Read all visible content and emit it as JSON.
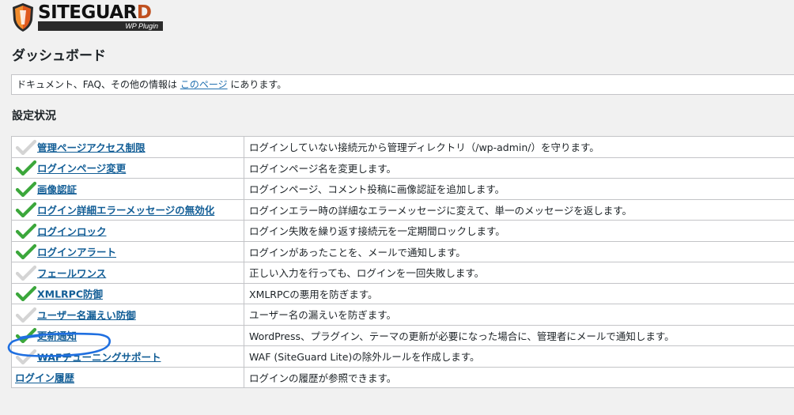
{
  "logo": {
    "brand_main": "SITEGUAR",
    "brand_accent": "D",
    "sub": "WP Plugin"
  },
  "page": {
    "title": "ダッシュボード"
  },
  "notice": {
    "prefix": "ドキュメント、FAQ、その他の情報は ",
    "link": "このページ",
    "suffix": " にあります。"
  },
  "section": {
    "title": "設定状況"
  },
  "colors": {
    "enabled_check": "#3ba73b",
    "disabled_check": "#d4d4d4",
    "annotation": "#1f6fe0"
  },
  "features": [
    {
      "name": "管理ページアクセス制限",
      "status": "disabled",
      "desc": "ログインしていない接続元から管理ディレクトリ（/wp-admin/）を守ります。"
    },
    {
      "name": "ログインページ変更",
      "status": "enabled",
      "desc": "ログインページ名を変更します。"
    },
    {
      "name": "画像認証",
      "status": "enabled",
      "desc": "ログインページ、コメント投稿に画像認証を追加します。"
    },
    {
      "name": "ログイン詳細エラーメッセージの無効化",
      "status": "enabled",
      "desc": "ログインエラー時の詳細なエラーメッセージに変えて、単一のメッセージを返します。"
    },
    {
      "name": "ログインロック",
      "status": "enabled",
      "desc": "ログイン失敗を繰り返す接続元を一定期間ロックします。"
    },
    {
      "name": "ログインアラート",
      "status": "enabled",
      "desc": "ログインがあったことを、メールで通知します。"
    },
    {
      "name": "フェールワンス",
      "status": "disabled",
      "desc": "正しい入力を行っても、ログインを一回失敗します。"
    },
    {
      "name": "XMLRPC防御",
      "status": "enabled",
      "desc": "XMLRPCの悪用を防ぎます。"
    },
    {
      "name": "ユーザー名漏えい防御",
      "status": "disabled",
      "desc": "ユーザー名の漏えいを防ぎます。"
    },
    {
      "name": "更新通知",
      "status": "enabled",
      "desc": "WordPress、プラグイン、テーマの更新が必要になった場合に、管理者にメールで通知します。"
    },
    {
      "name": "WAFチューニングサポート",
      "status": "disabled",
      "desc": "WAF (SiteGuard Lite)の除外ルールを作成します。"
    },
    {
      "name": "ログイン履歴",
      "status": "none",
      "desc": "ログインの履歴が参照できます。"
    }
  ]
}
